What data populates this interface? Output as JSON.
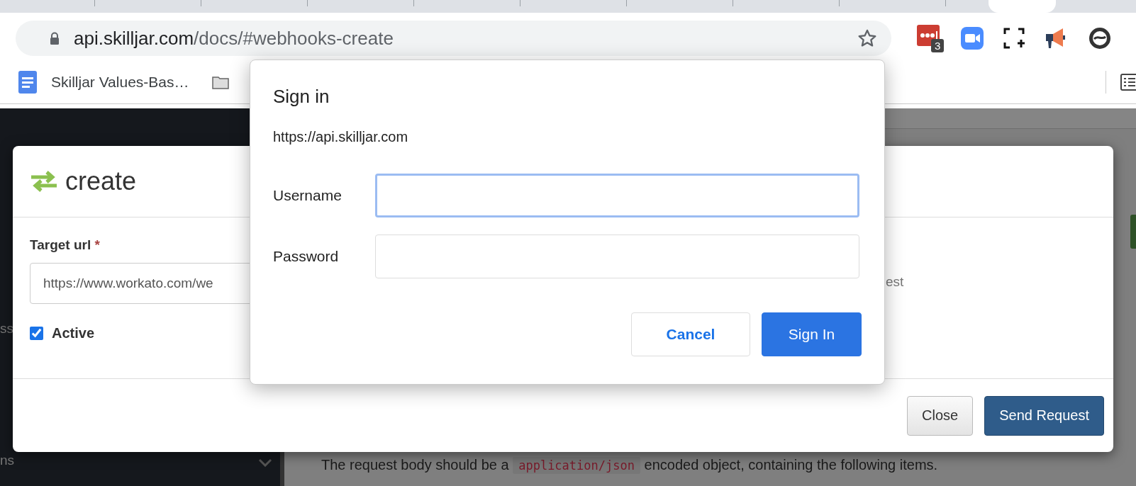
{
  "browser": {
    "address_bar": {
      "host": "api.skilljar.com",
      "path": "/docs/#webhooks-create"
    },
    "extensions": [
      {
        "kind": "password",
        "badge": "3"
      },
      {
        "kind": "video"
      },
      {
        "kind": "capture"
      },
      {
        "kind": "megaphone"
      },
      {
        "kind": "ring"
      }
    ],
    "bookmarks": [
      {
        "kind": "doc",
        "label": "Skilljar Values-Bas…"
      },
      {
        "kind": "folder"
      }
    ]
  },
  "page": {
    "sidebar_fragments": [
      "ss",
      "ns"
    ],
    "body_text": {
      "before": "The request body should be a",
      "code": "application/json",
      "after": "encoded object, containing the following items."
    }
  },
  "create_modal": {
    "title": "create",
    "target_url": {
      "label": "Target url",
      "required_mark": "*",
      "value": "https://www.workato.com/we"
    },
    "active": {
      "label": "Active",
      "checked": true
    },
    "fragment": "est",
    "buttons": [
      {
        "label": "Close",
        "kind": "default"
      },
      {
        "label": "Send Request",
        "kind": "primary"
      }
    ]
  },
  "sign_in_dialog": {
    "title": "Sign in",
    "origin": "https://api.skilljar.com",
    "fields": [
      {
        "label": "Username",
        "focused": true
      },
      {
        "label": "Password",
        "focused": false
      }
    ],
    "buttons": [
      {
        "label": "Cancel",
        "kind": "secondary"
      },
      {
        "label": "Sign In",
        "kind": "primary"
      }
    ]
  }
}
